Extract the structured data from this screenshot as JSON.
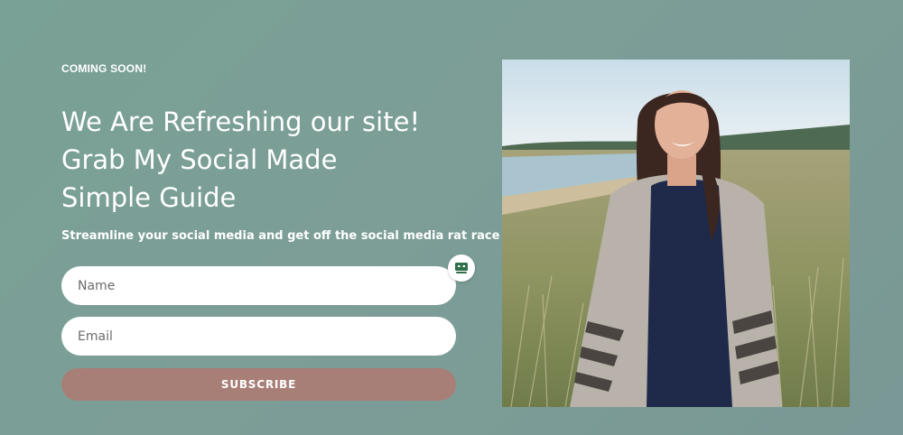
{
  "hero": {
    "eyebrow": "COMING SOON!",
    "headline_lines": [
      "We Are Refreshing our site!",
      "Grab My Social Made",
      "Simple Guide"
    ],
    "subline": "Streamline your social media and get off the social media rat race"
  },
  "form": {
    "name_placeholder": "Name",
    "email_placeholder": "Email",
    "subscribe_label": "SUBSCRIBE"
  },
  "icons": {
    "form_helper": "password-manager-icon"
  },
  "colors": {
    "background": "#7a9e95",
    "button": "#a87f77",
    "text": "#ffffff"
  }
}
